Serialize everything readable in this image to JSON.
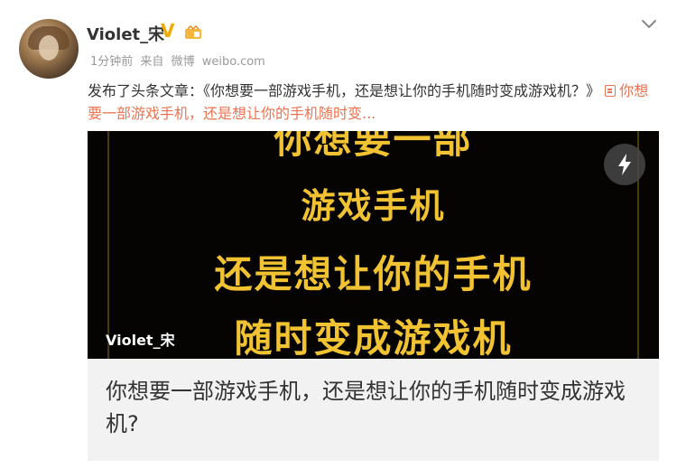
{
  "post": {
    "username": "Violet_宋",
    "verified_badge": "V",
    "time": "1分钟前",
    "source_prefix": "来自",
    "source_app": "微博",
    "source_site": "weibo.com",
    "text_prefix": "发布了头条文章：",
    "article_quote": "《你想要一部游戏手机，还是想让你的手机随时变成游戏机？》",
    "article_link": "你想要一部游戏手机，还是想让你的手机随时变..."
  },
  "card": {
    "cover_lines": [
      "你想要一部",
      "游戏手机",
      "还是想让你的手机",
      "随时变成游戏机"
    ],
    "watermark": "Violet_宋",
    "title": "你想要一部游戏手机，还是想让你的手机随时变成游戏机?"
  },
  "icons": {
    "more": "chevron-down-icon",
    "flash": "lightning-icon",
    "article": "article-link-icon",
    "verified": "verified-v-icon",
    "level": "level-badge-icon"
  },
  "colors": {
    "link": "#eb7350",
    "cover_text": "#f1c332",
    "cover_bg": "#050403",
    "card_bg": "#f2f2f2",
    "verified": "#f2a900"
  }
}
